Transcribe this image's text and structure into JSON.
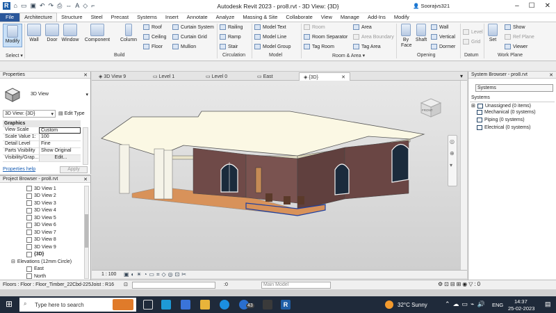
{
  "titlebar": {
    "title": "Autodesk Revit 2023 - pro8.rvt - 3D View: {3D}",
    "user": "Soorajvs321",
    "minimize": "–",
    "maximize": "☐",
    "close": "✕"
  },
  "tabs": [
    "File",
    "Architecture",
    "Structure",
    "Steel",
    "Precast",
    "Systems",
    "Insert",
    "Annotate",
    "Analyze",
    "Massing & Site",
    "Collaborate",
    "View",
    "Manage",
    "Add-Ins",
    "Modify"
  ],
  "ribbon": {
    "modify": "Modify",
    "wall": "Wall",
    "door": "Door",
    "window": "Window",
    "component": "Component",
    "column": "Column",
    "roof": "Roof",
    "ceiling": "Ceiling",
    "floor": "Floor",
    "curtain_system": "Curtain System",
    "curtain_grid": "Curtain Grid",
    "mullion": "Mullion",
    "railing": "Railing",
    "ramp": "Ramp",
    "stair": "Stair",
    "model_text": "Model Text",
    "model_line": "Model Line",
    "model_group": "Model Group",
    "room": "Room",
    "room_separator": "Room Separator",
    "tag_room": "Tag Room",
    "area": "Area",
    "area_boundary": "Area Boundary",
    "tag_area": "Tag Area",
    "by_face": "By Face",
    "shaft": "Shaft",
    "opening_wall": "Wall",
    "vertical": "Vertical",
    "dormer": "Dormer",
    "level": "Level",
    "grid": "Grid",
    "set": "Set",
    "show": "Show",
    "ref_plane": "Ref Plane",
    "viewer": "Viewer",
    "groups": {
      "select": "Select ▾",
      "build": "Build",
      "circulation": "Circulation",
      "model": "Model",
      "room_area": "Room & Area ▾",
      "opening": "Opening",
      "datum": "Datum",
      "work_plane": "Work Plane"
    }
  },
  "properties": {
    "header": "Properties",
    "type_name": "3D View",
    "selector": "3D View: {3D}",
    "edit_type": "Edit Type",
    "section": "Graphics",
    "rows": [
      {
        "label": "View Scale",
        "value": "Custom"
      },
      {
        "label": "Scale Value  1:",
        "value": "100"
      },
      {
        "label": "Detail Level",
        "value": "Fine"
      },
      {
        "label": "Parts Visibility",
        "value": "Show Original"
      },
      {
        "label": "Visibility/Grap...",
        "value": "Edit..."
      }
    ],
    "help": "Properties help",
    "apply": "Apply"
  },
  "project_browser": {
    "header": "Project Browser - pro8.rvt",
    "items": [
      "3D View 1",
      "3D View 2",
      "3D View 3",
      "3D View 4",
      "3D View 5",
      "3D View 6",
      "3D View 7",
      "3D View 8",
      "3D View 9",
      "{3D}"
    ],
    "elevations": "Elevations (12mm Circle)",
    "elev_items": [
      "East",
      "North"
    ]
  },
  "view_tabs": [
    "3D View 9",
    "Level 1",
    "Level 0",
    "East",
    "{3D}"
  ],
  "view_control": {
    "scale": "1 : 100"
  },
  "system_browser": {
    "header": "System Browser - pro8.rvt",
    "dropdown": "Systems",
    "col_header": "Systems",
    "items": [
      "Unassigned (0 items)",
      "Mechanical (0 systems)",
      "Piping (0 systems)",
      "Electrical (0 systems)"
    ]
  },
  "status": {
    "text": "Floors : Floor : Floor_Timber_22Cbd-225Joist : R16",
    "zero": ":0",
    "model": "Main Model"
  },
  "taskbar": {
    "search": "Type here to search",
    "weather": "32°C  Sunny",
    "lang": "ENG",
    "time": "14:37",
    "date": "25-02-2023",
    "badge": "43"
  },
  "viewcube": {
    "label": "FRONT"
  }
}
